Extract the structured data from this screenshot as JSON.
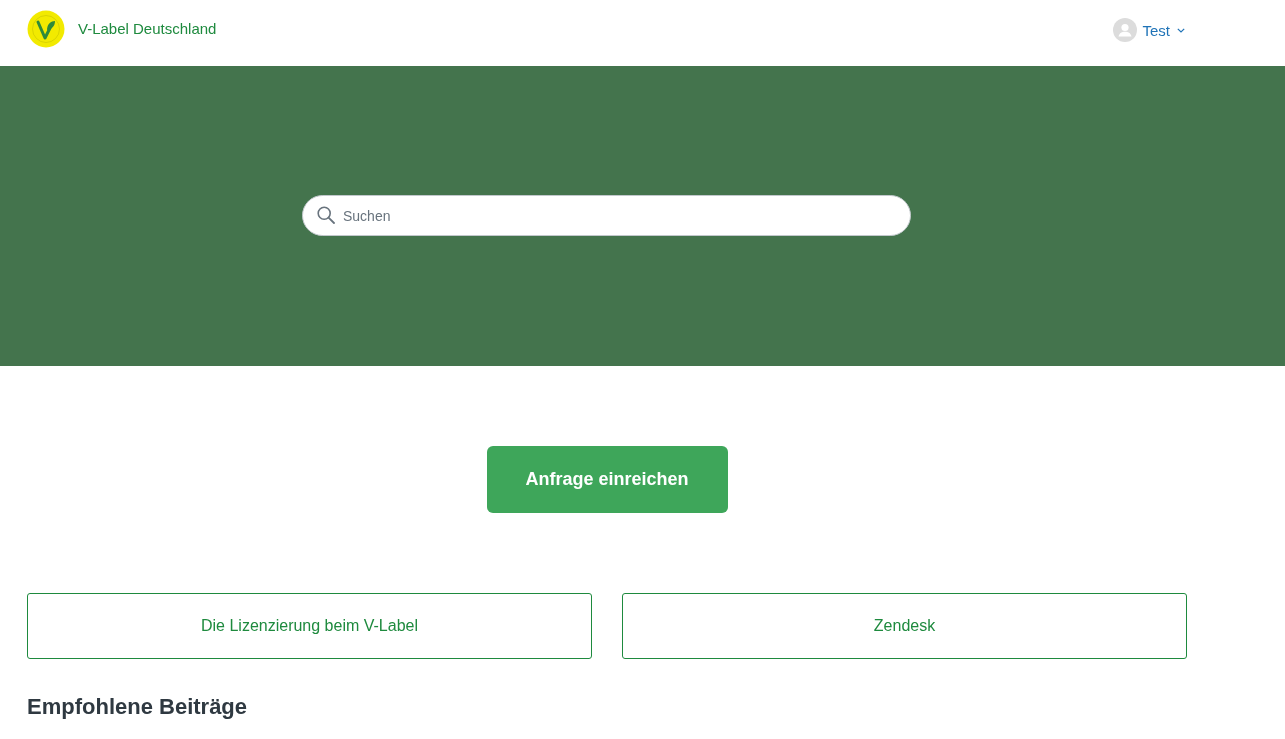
{
  "header": {
    "brand": "V-Label Deutschland",
    "user": {
      "name": "Test"
    }
  },
  "hero": {
    "search": {
      "placeholder": "Suchen"
    }
  },
  "request_button": {
    "label": "Anfrage einreichen"
  },
  "category_blocks": [
    {
      "label": "Die Lizenzierung beim V-Label"
    },
    {
      "label": "Zendesk"
    }
  ],
  "promoted_articles": {
    "title": "Empfohlene Beiträge"
  }
}
